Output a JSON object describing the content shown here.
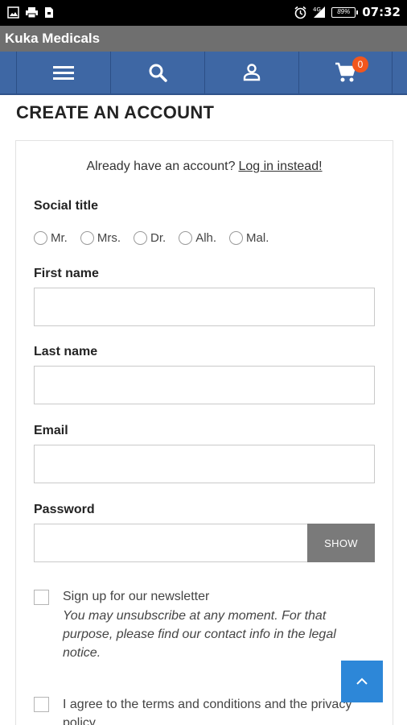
{
  "status_bar": {
    "time": "07:32",
    "battery": "89%",
    "icons": [
      "image-icon",
      "printer-icon",
      "sd-card-icon",
      "alarm-icon",
      "signal-icon",
      "battery-icon"
    ]
  },
  "app": {
    "title": "Kuka Medicals"
  },
  "nav": {
    "items": [
      "menu-icon",
      "search-icon",
      "account-icon",
      "cart-icon"
    ],
    "cart_count": "0",
    "bg_color": "#3e67a4",
    "badge_color": "#f2561d"
  },
  "page": {
    "title": "CREATE AN ACCOUNT"
  },
  "form": {
    "already_text": "Already have an account?",
    "login_link": "Log in instead!",
    "social_title_label": "Social title",
    "social_titles": [
      "Mr.",
      "Mrs.",
      "Dr.",
      "Alh.",
      "Mal."
    ],
    "first_name_label": "First name",
    "last_name_label": "Last name",
    "email_label": "Email",
    "password_label": "Password",
    "show_label": "SHOW",
    "newsletter_label": "Sign up for our newsletter",
    "newsletter_note": "You may unsubscribe at any moment. For that purpose, please find our contact info in the legal notice.",
    "terms_label": "I agree to the terms and conditions and the privacy policy"
  },
  "scroll_top": {
    "icon": "chevron-up-icon",
    "color": "#2d87d8"
  }
}
